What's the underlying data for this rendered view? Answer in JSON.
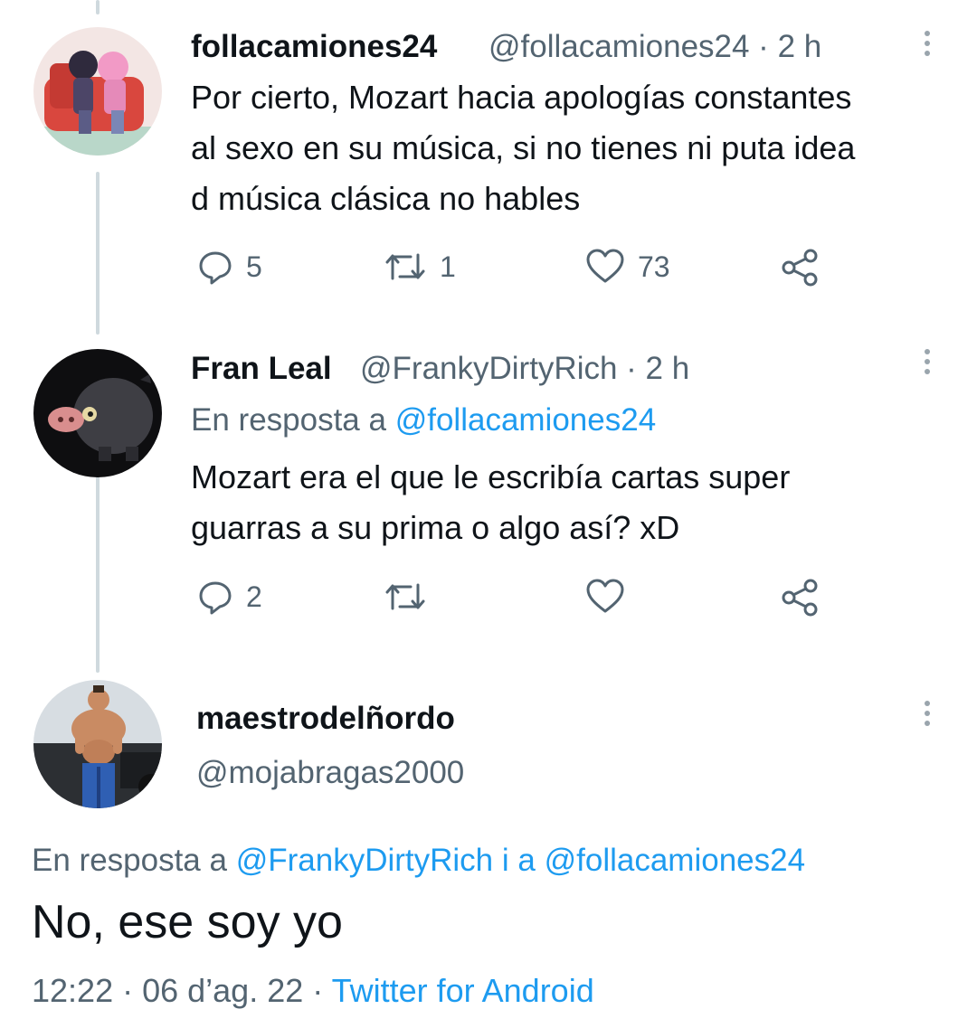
{
  "tweets": [
    {
      "name": "follacamiones24",
      "handle_time": "@follacamiones24 · 2 h",
      "lines": [
        "Por cierto, Mozart hacia apologías constantes",
        "al sexo en su música, si no tienes ni puta idea",
        "d música clásica no hables"
      ],
      "replies": "5",
      "retweets": "1",
      "likes": "73"
    },
    {
      "name": "Fran Leal",
      "handle_time": "@FrankyDirtyRich · 2 h",
      "reply_prefix": "En resposta a",
      "reply_to": "@follacamiones24",
      "lines": [
        "Mozart era el que le escribía cartas super",
        "guarras a su prima o algo así? xD"
      ],
      "replies": "2"
    }
  ],
  "focused": {
    "name": "maestrodelñordo",
    "handle": "@mojabragas2000",
    "reply_prefix": "En resposta a",
    "reply_to_1": "@FrankyDirtyRich",
    "reply_join": "i a",
    "reply_to_2": "@follacamiones24",
    "text": "No, ese soy yo",
    "timestamp": "12:22 · 06 d’ag. 22 ·",
    "source": "Twitter for Android"
  },
  "colors": {
    "accent": "#1d9bf0",
    "secondary_text": "#536471",
    "primary_text": "#0f1419",
    "thread_line": "#cfd9de"
  },
  "icons": [
    "reply-icon",
    "retweet-icon",
    "like-icon",
    "share-icon",
    "more-icon"
  ]
}
